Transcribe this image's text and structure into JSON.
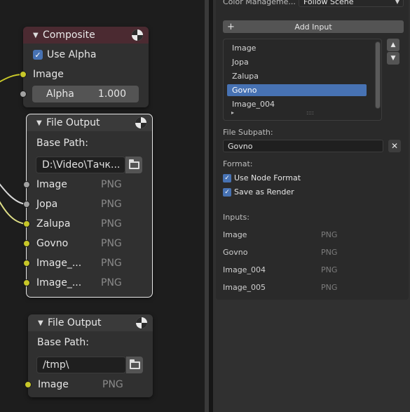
{
  "composite_node": {
    "title": "Composite",
    "use_alpha_label": "Use Alpha",
    "use_alpha_checked": true,
    "image_label": "Image",
    "alpha_label": "Alpha",
    "alpha_value": "1.000"
  },
  "file_output_1": {
    "title": "File Output",
    "base_path_label": "Base Path:",
    "base_path_value": "D:\\Video\\Тачк...",
    "inputs": [
      {
        "name": "Image",
        "format": "PNG"
      },
      {
        "name": "Jopa",
        "format": "PNG"
      },
      {
        "name": "Zalupa",
        "format": "PNG"
      },
      {
        "name": "Govno",
        "format": "PNG"
      },
      {
        "name": "Image_...",
        "format": "PNG"
      },
      {
        "name": "Image_...",
        "format": "PNG"
      }
    ]
  },
  "file_output_2": {
    "title": "File Output",
    "base_path_label": "Base Path:",
    "base_path_value": "/tmp\\",
    "inputs": [
      {
        "name": "Image",
        "format": "PNG"
      }
    ]
  },
  "panel": {
    "color_management_label": "Color Manageme...",
    "color_management_value": "Follow Scene",
    "add_input_label": "Add Input",
    "add_icon": "+",
    "list_items": [
      "Image",
      "Jopa",
      "Zalupa",
      "Govno",
      "Image_004"
    ],
    "active_index": 3,
    "list_more": "▸",
    "grip": "::::",
    "move_up_icon": "▲",
    "move_down_icon": "▼",
    "file_subpath_label": "File Subpath:",
    "file_subpath_value": "Govno",
    "clear_icon": "✕",
    "format_label": "Format:",
    "use_node_format_label": "Use Node Format",
    "use_node_format_checked": true,
    "save_as_render_label": "Save as Render",
    "save_as_render_checked": true,
    "inputs_label": "Inputs:",
    "inputs": [
      {
        "name": "Image",
        "format": "PNG"
      },
      {
        "name": "Govno",
        "format": "PNG"
      },
      {
        "name": "Image_004",
        "format": "PNG"
      },
      {
        "name": "Image_005",
        "format": "PNG"
      }
    ]
  },
  "colors": {
    "socket_yellow": "#c7c729",
    "socket_grey": "#a1a1a1",
    "accent": "#4772b3",
    "composite_header": "#4b2a31"
  }
}
